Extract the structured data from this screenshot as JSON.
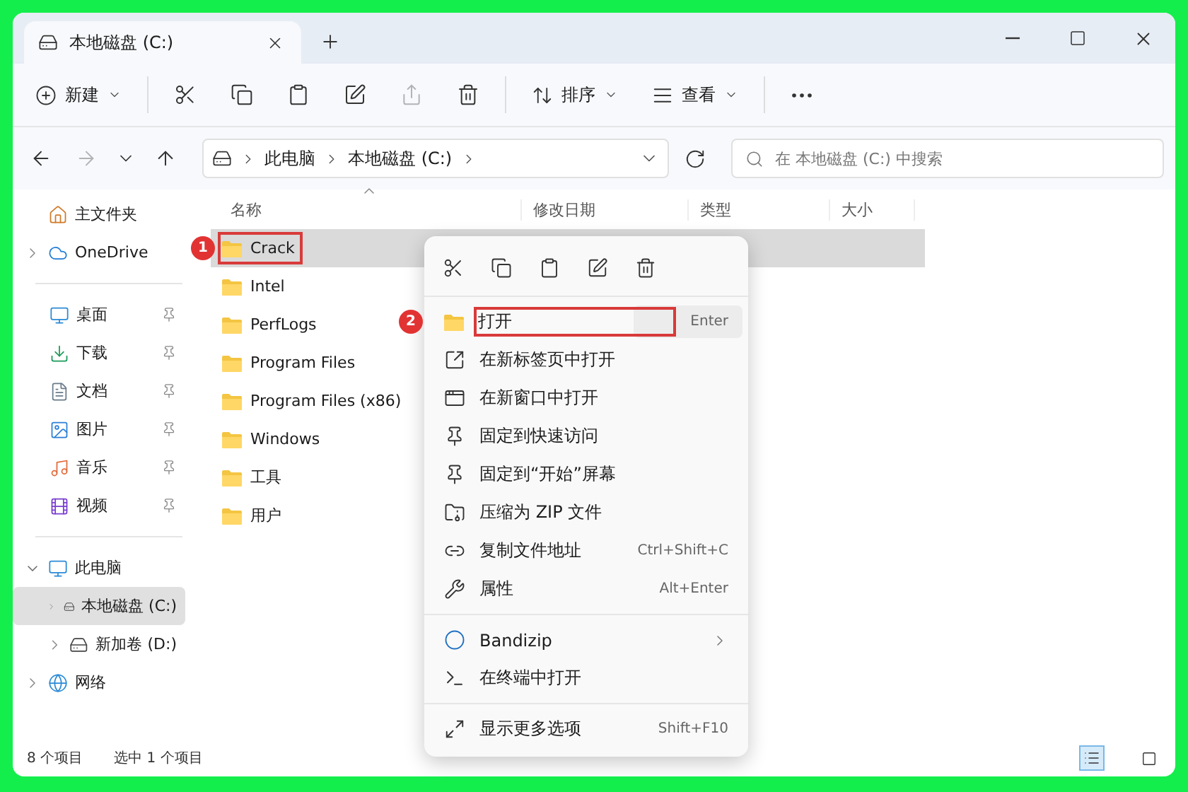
{
  "window": {
    "tab_title": "本地磁盘 (C:)"
  },
  "toolbar": {
    "new_label": "新建",
    "sort_label": "排序",
    "view_label": "查看",
    "share_disabled": true
  },
  "address": {
    "path": [
      "此电脑",
      "本地磁盘 (C:)"
    ]
  },
  "search": {
    "placeholder": "在 本地磁盘 (C:) 中搜索"
  },
  "sidebar": {
    "top": [
      {
        "label": "主文件夹",
        "expandable": false
      },
      {
        "label": "OneDrive",
        "expandable": true
      }
    ],
    "pinned": [
      {
        "label": "桌面",
        "pinned": true
      },
      {
        "label": "下载",
        "pinned": true
      },
      {
        "label": "文档",
        "pinned": true
      },
      {
        "label": "图片",
        "pinned": true
      },
      {
        "label": "音乐",
        "pinned": true
      },
      {
        "label": "视频",
        "pinned": true
      }
    ],
    "tree": [
      {
        "label": "此电脑",
        "expanded": true,
        "selected": false,
        "children": [
          {
            "label": "本地磁盘 (C:)",
            "expanded": false,
            "selected": true
          },
          {
            "label": "新加卷 (D:)",
            "expanded": false,
            "selected": false
          }
        ]
      },
      {
        "label": "网络",
        "expanded": false,
        "selected": false
      }
    ]
  },
  "table": {
    "columns": [
      "名称",
      "修改日期",
      "类型",
      "大小"
    ],
    "rows": [
      {
        "name": "Crack",
        "selected": true,
        "marker": "1"
      },
      {
        "name": "Intel",
        "selected": false
      },
      {
        "name": "PerfLogs",
        "selected": false
      },
      {
        "name": "Program Files",
        "selected": false
      },
      {
        "name": "Program Files (x86)",
        "selected": false
      },
      {
        "name": "Windows",
        "selected": false
      },
      {
        "name": "工具",
        "selected": false
      },
      {
        "name": "用户",
        "selected": false
      }
    ]
  },
  "context_menu": {
    "groups": [
      [
        {
          "kind": "item",
          "label": "打开",
          "shortcut": "Enter",
          "highlighted": true,
          "marker": "2"
        },
        {
          "kind": "item",
          "label": "在新标签页中打开",
          "highlighted": false
        },
        {
          "kind": "item",
          "label": "在新窗口中打开",
          "highlighted": false
        },
        {
          "kind": "item",
          "label": "固定到快速访问",
          "highlighted": false
        },
        {
          "kind": "item",
          "label": "固定到“开始”屏幕",
          "highlighted": false
        },
        {
          "kind": "item",
          "label": "压缩为 ZIP 文件",
          "highlighted": false
        },
        {
          "kind": "item",
          "label": "复制文件地址",
          "shortcut": "Ctrl+Shift+C",
          "highlighted": false
        },
        {
          "kind": "item",
          "label": "属性",
          "shortcut": "Alt+Enter",
          "highlighted": false
        }
      ],
      [
        {
          "kind": "submenu",
          "label": "Bandizip",
          "highlighted": false
        },
        {
          "kind": "item",
          "label": "在终端中打开",
          "highlighted": false
        }
      ],
      [
        {
          "kind": "item",
          "label": "显示更多选项",
          "shortcut": "Shift+F10",
          "highlighted": false
        }
      ]
    ]
  },
  "status_bar": {
    "count": "8 个项目",
    "selection": "选中 1 个项目",
    "views": [
      {
        "selected": true
      },
      {
        "selected": false
      }
    ]
  }
}
